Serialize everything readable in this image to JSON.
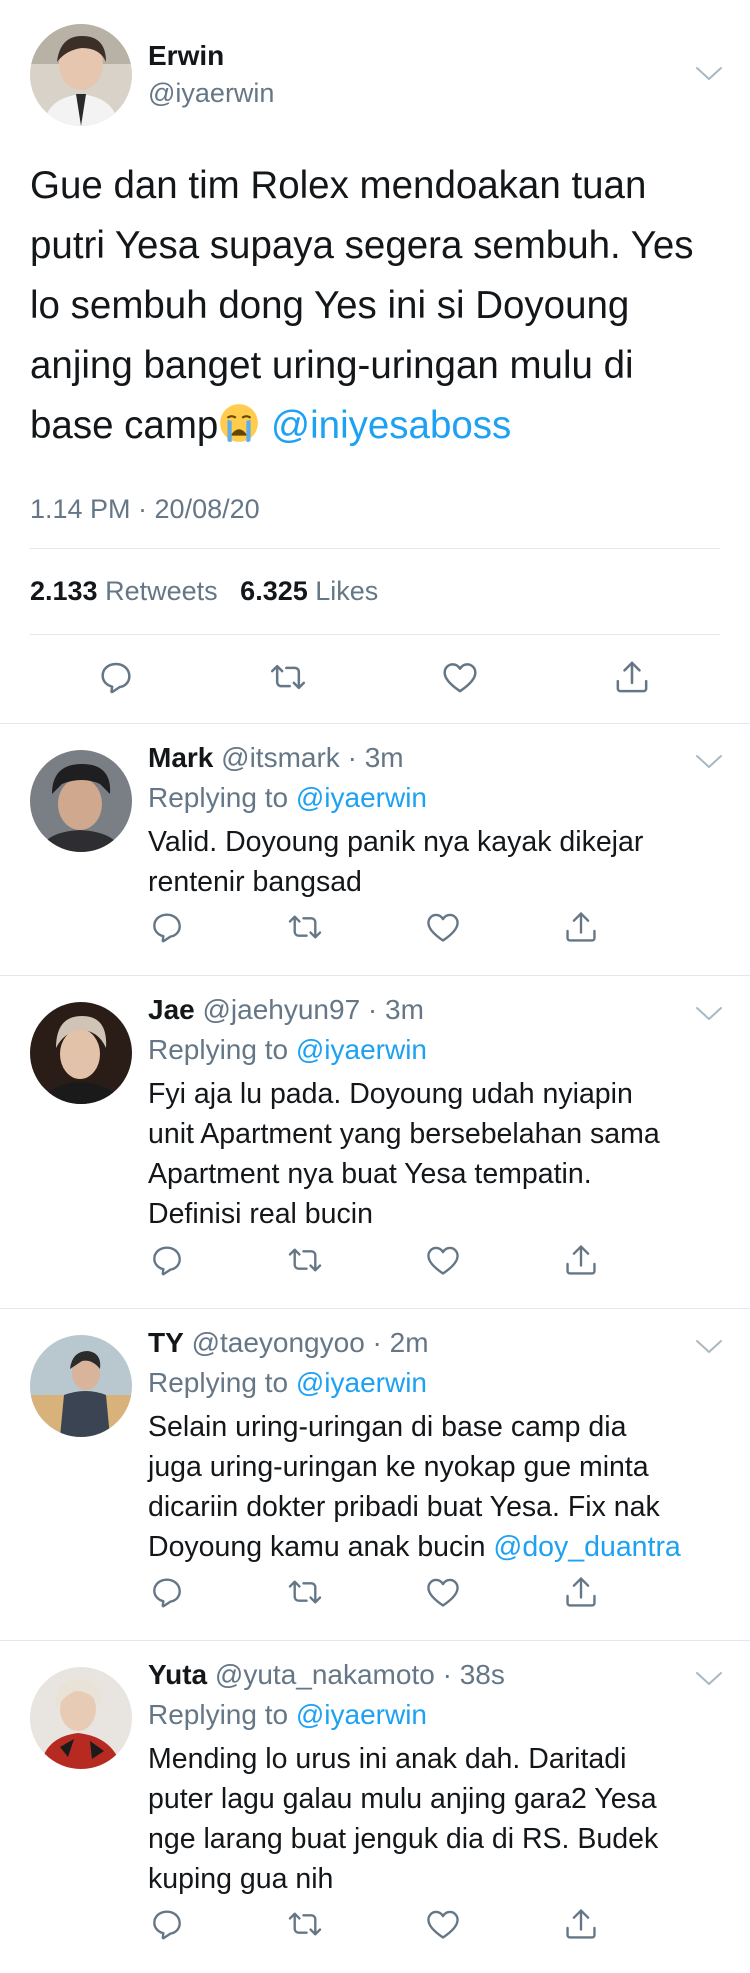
{
  "main_tweet": {
    "author_name": "Erwin",
    "author_handle": "@iyaerwin",
    "text_lines": [
      "Gue dan tim Rolex mendoakan tuan",
      "putri Yesa supaya segera sembuh. Yes",
      "lo sembuh dong Yes ini si Doyoung",
      "anjing banget uring-uringan mulu di"
    ],
    "text_last": "base camp",
    "emoji": "loudly-crying-face",
    "mention": "@iniyesaboss",
    "timestamp": "1.14 PM · 20/08/20",
    "retweet_count": "2.133",
    "retweet_label": "Retweets",
    "like_count": "6.325",
    "like_label": "Likes"
  },
  "replies": [
    {
      "name": "Mark",
      "handle": "@itsmark",
      "time": "3m",
      "replying_label": "Replying to",
      "replying_to": "@iyaerwin",
      "lines": [
        "Valid. Doyoung panik nya kayak dikejar",
        "rentenir bangsad"
      ]
    },
    {
      "name": "Jae",
      "handle": "@jaehyun97",
      "time": "3m",
      "replying_label": "Replying to",
      "replying_to": "@iyaerwin",
      "lines": [
        "Fyi aja lu pada. Doyoung udah nyiapin",
        "unit Apartment yang bersebelahan sama",
        "Apartment nya buat Yesa tempatin.",
        "Definisi real bucin"
      ]
    },
    {
      "name": "TY",
      "handle": "@taeyongyoo",
      "time": "2m",
      "replying_label": "Replying to",
      "replying_to": "@iyaerwin",
      "lines": [
        "Selain uring-uringan di base camp dia",
        "juga uring-uringan ke nyokap gue minta",
        "dicariin dokter pribadi buat Yesa. Fix nak"
      ],
      "last_line": "Doyoung kamu anak bucin",
      "mention": "@doy_duantra"
    },
    {
      "name": "Yuta",
      "handle": "@yuta_nakamoto",
      "time": "38s",
      "replying_label": "Replying to",
      "replying_to": "@iyaerwin",
      "lines": [
        "Mending lo urus ini anak dah. Daritadi",
        "puter lagu galau mulu anjing gara2 Yesa",
        "nge larang buat jenguk dia di RS. Budek",
        "kuping gua nih"
      ]
    }
  ],
  "colors": {
    "text": "#14171a",
    "secondary": "#657786",
    "link": "#1da1f2",
    "divider": "#e1e8ed"
  }
}
